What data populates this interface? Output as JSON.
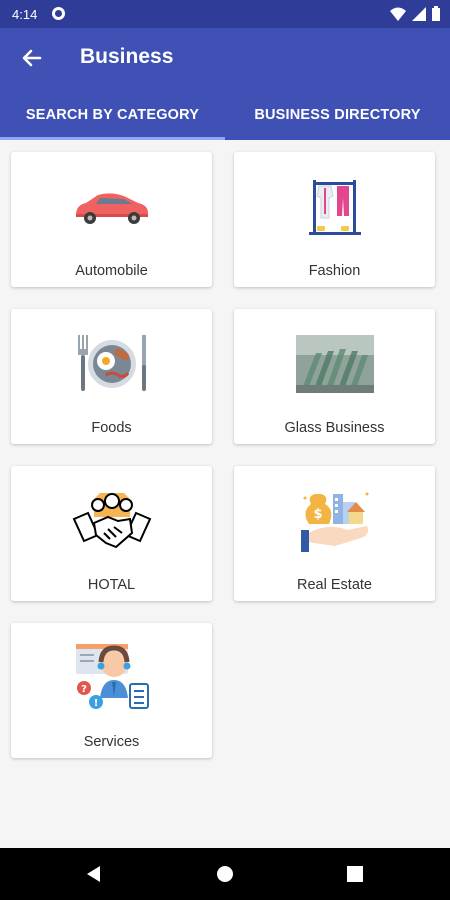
{
  "status_bar": {
    "time": "4:14"
  },
  "app_bar": {
    "title": "Business"
  },
  "tabs": [
    {
      "label": "SEARCH BY CATEGORY",
      "active": true
    },
    {
      "label": "BUSINESS DIRECTORY",
      "active": false
    }
  ],
  "categories": [
    {
      "label": "Automobile",
      "icon": "car-icon"
    },
    {
      "label": "Fashion",
      "icon": "clothes-rack-icon"
    },
    {
      "label": "Foods",
      "icon": "breakfast-plate-icon"
    },
    {
      "label": "Glass Business",
      "icon": "glass-sheets-icon"
    },
    {
      "label": "HOTAL",
      "icon": "handshake-icon"
    },
    {
      "label": "Real Estate",
      "icon": "real-estate-icon"
    },
    {
      "label": "Services",
      "icon": "customer-service-icon"
    }
  ],
  "colors": {
    "primary": "#3f51b5",
    "status_bar": "#2f3d99",
    "tab_indicator": "#90a4ff"
  }
}
